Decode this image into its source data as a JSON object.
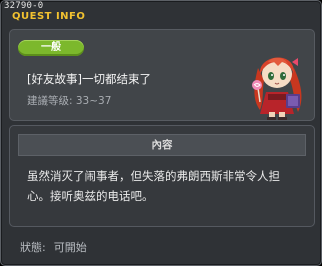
{
  "window": {
    "quest_id": "32790-0",
    "title": "QUEST INFO"
  },
  "quest": {
    "category_badge": "一般",
    "name": "[好友故事]一切都结束了",
    "recommended_level": "建議等级: 33~37"
  },
  "content": {
    "header": "內容",
    "text": "虽然消灭了闹事者，但失落的弗朗西斯非常令人担心。接听奥兹的电话吧。"
  },
  "status": {
    "label": "狀態:",
    "value": "可開始"
  },
  "colors": {
    "title_accent": "#f2c230",
    "badge_green": "#7cb82c"
  }
}
